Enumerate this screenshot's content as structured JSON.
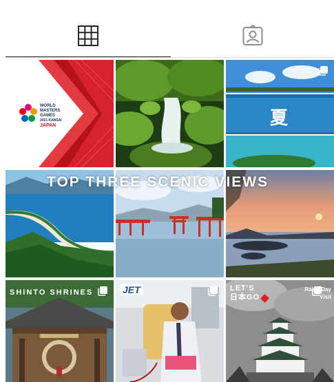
{
  "tabs": [
    {
      "name": "posts-grid",
      "icon": "grid-icon",
      "active": true
    },
    {
      "name": "tagged",
      "icon": "tagged-person-icon",
      "active": false
    }
  ],
  "posts": {
    "wmg": {
      "lines": [
        "WORLD",
        "MASTERS",
        "GAMES"
      ],
      "edition": "2021 KANSAI",
      "country": "JAPAN"
    },
    "summer_caption": "夏",
    "banner": "TOP THREE SCENIC VIEWS",
    "shinto": "SHINTO SHRINES",
    "jet_logo": "JET",
    "lets_go": {
      "line1": "LET'S",
      "line2": "日本GO"
    },
    "rainy_day": {
      "line1": "Rainy Day",
      "line2": "Visit"
    }
  },
  "colors": {
    "tab_active": "#262626",
    "tab_inactive": "#8e8e8e",
    "wmg_red": "#c8192a"
  }
}
